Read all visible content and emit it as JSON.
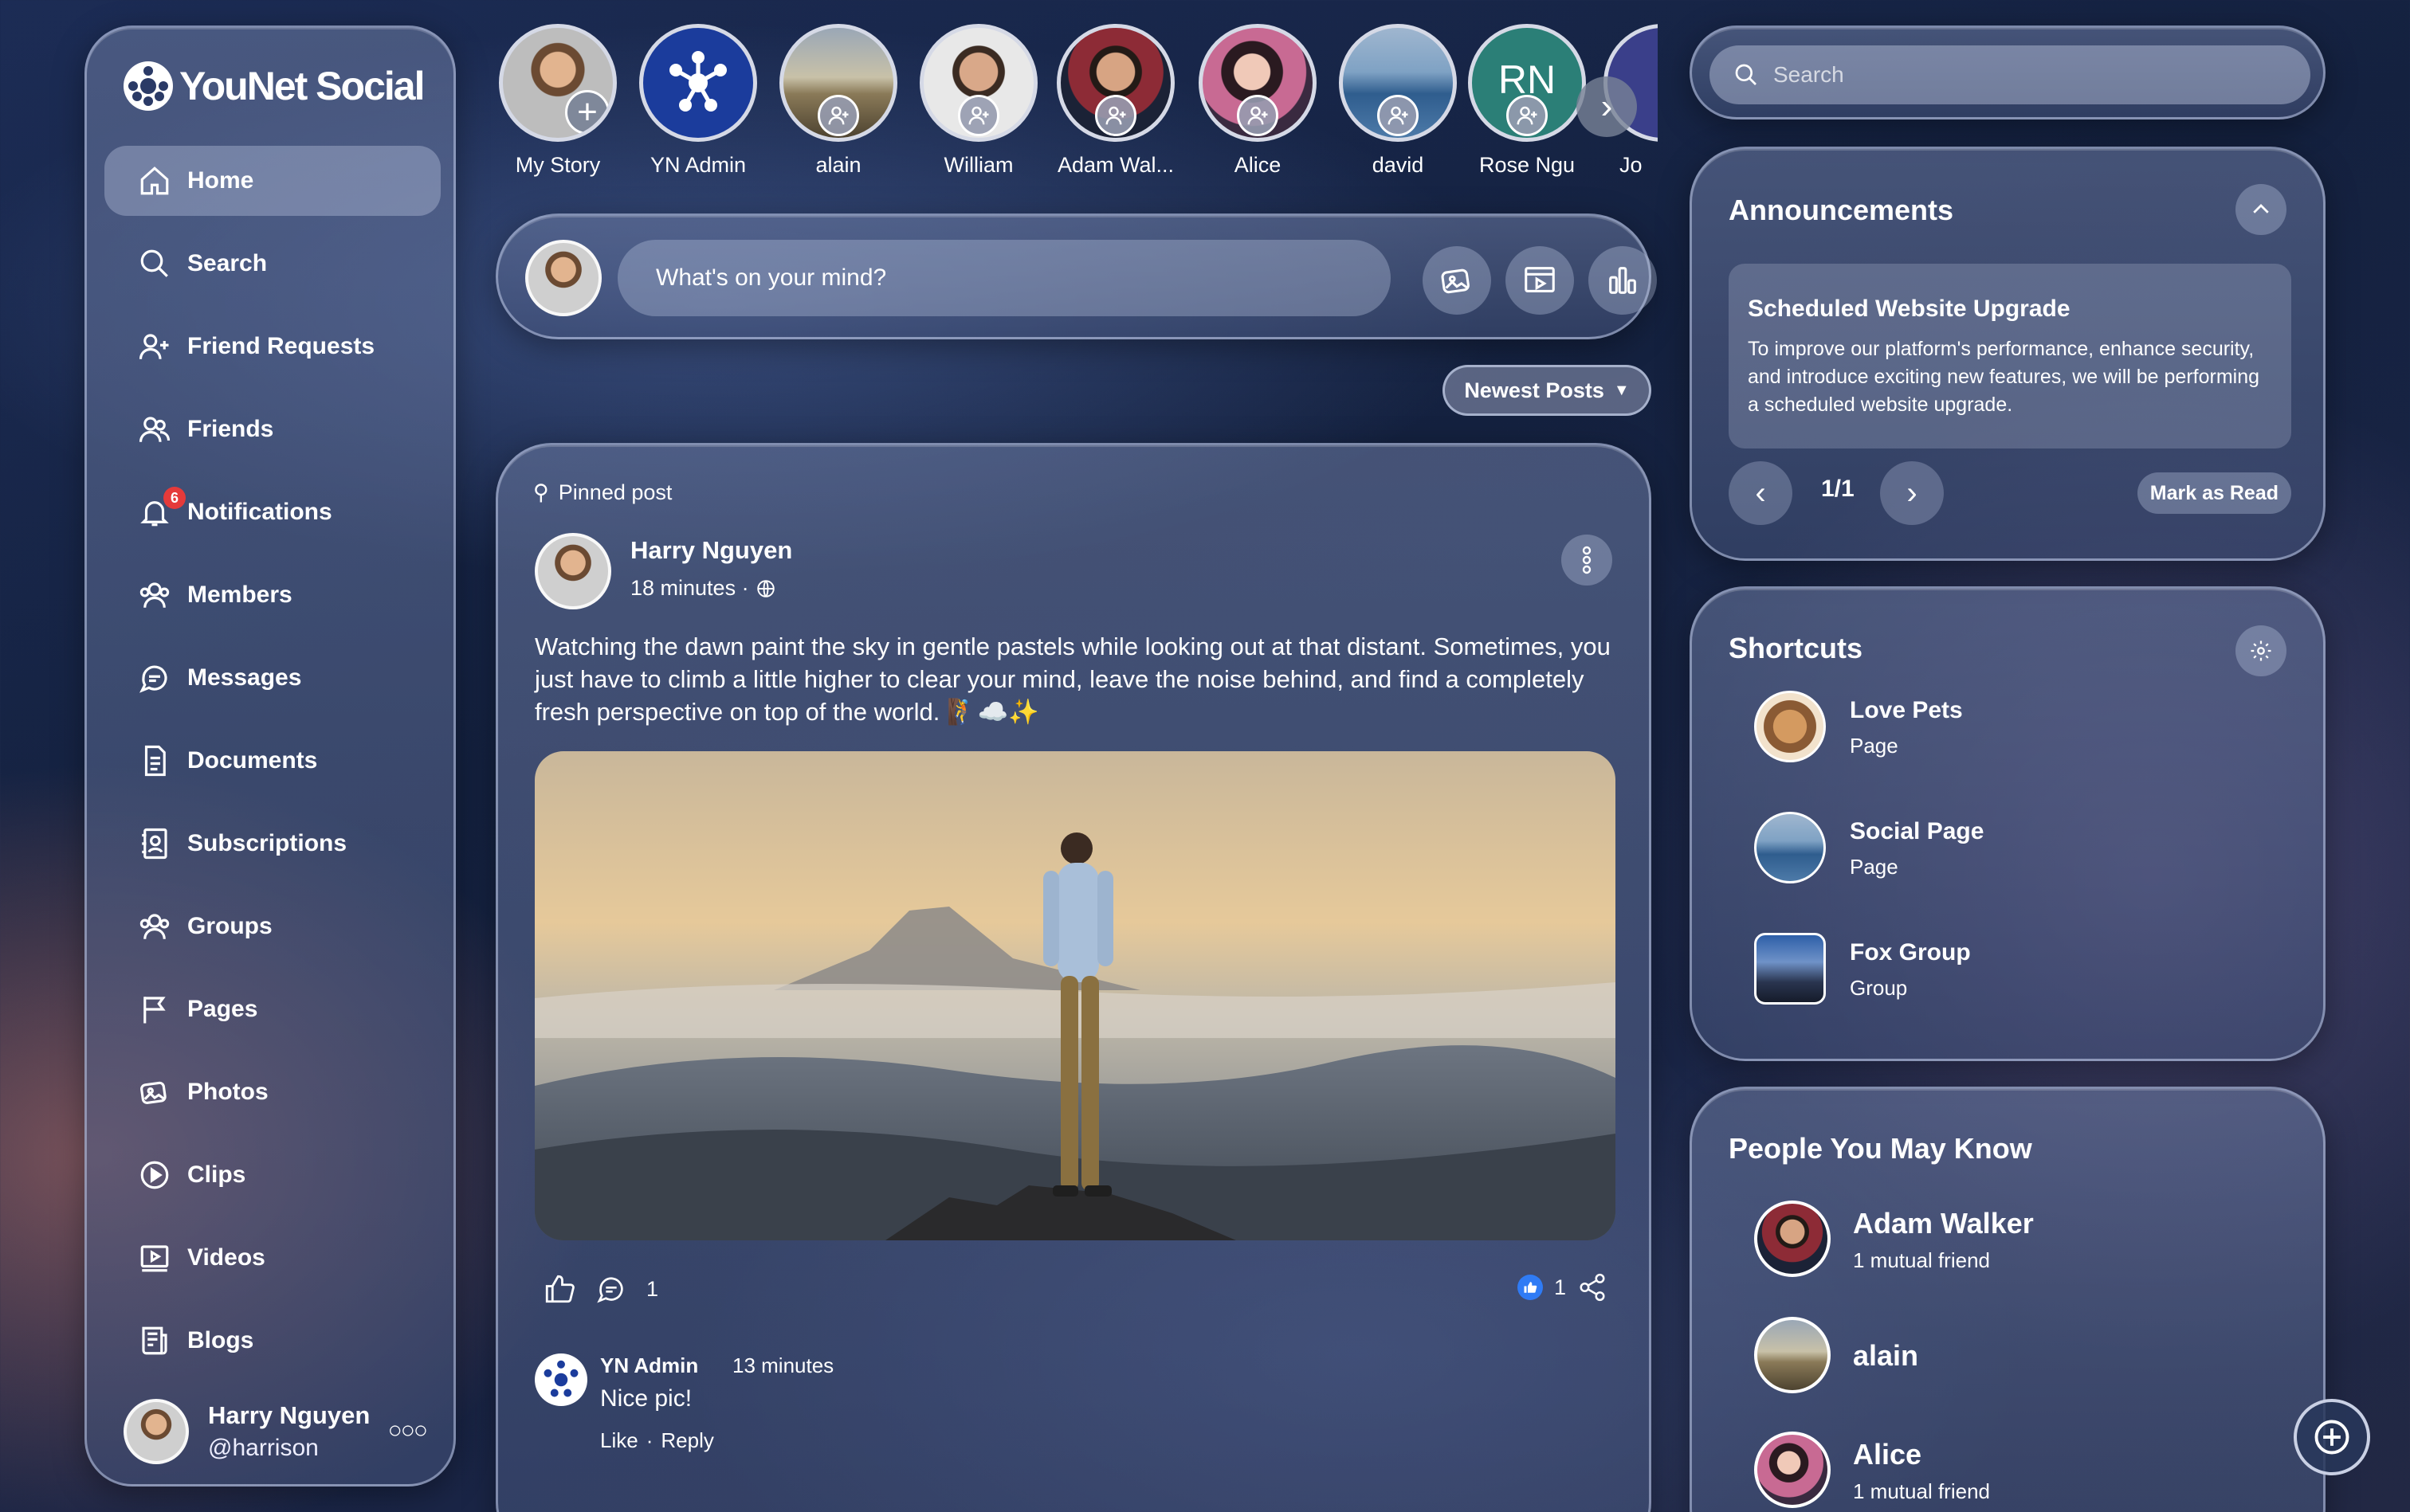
{
  "brand": {
    "name": "YouNet Social"
  },
  "nav": {
    "items": [
      {
        "label": "Home"
      },
      {
        "label": "Search"
      },
      {
        "label": "Friend Requests"
      },
      {
        "label": "Friends"
      },
      {
        "label": "Notifications",
        "badge": "6"
      },
      {
        "label": "Members"
      },
      {
        "label": "Messages"
      },
      {
        "label": "Documents"
      },
      {
        "label": "Subscriptions"
      },
      {
        "label": "Groups"
      },
      {
        "label": "Pages"
      },
      {
        "label": "Photos"
      },
      {
        "label": "Clips"
      },
      {
        "label": "Videos"
      },
      {
        "label": "Blogs"
      }
    ]
  },
  "profile": {
    "name": "Harry Nguyen",
    "handle": "@harrison"
  },
  "stories": [
    {
      "name": "My Story"
    },
    {
      "name": "YN Admin"
    },
    {
      "name": "alain"
    },
    {
      "name": "William"
    },
    {
      "name": "Adam Wal..."
    },
    {
      "name": "Alice"
    },
    {
      "name": "david"
    },
    {
      "name": "Rose Ngu",
      "initials": "RN"
    },
    {
      "name": "Jo"
    }
  ],
  "composer": {
    "placeholder": "What's on your mind?"
  },
  "sort": {
    "label": "Newest Posts"
  },
  "post": {
    "pinned_label": "Pinned post",
    "author": "Harry Nguyen",
    "time": "18 minutes ·",
    "text": "Watching the dawn paint the sky in gentle pastels while looking out at that distant. Sometimes, you just have to climb a little higher to clear your mind, leave the noise behind, and find a completely fresh perspective on top of the world. 🧗☁️✨",
    "comment_count": "1",
    "like_count": "1",
    "comment": {
      "author": "YN Admin",
      "time": "13 minutes",
      "text": "Nice pic!",
      "like": "Like",
      "sep": "·",
      "reply": "Reply"
    }
  },
  "search": {
    "placeholder": "Search"
  },
  "announcements": {
    "title": "Announcements",
    "item_title": "Scheduled Website Upgrade",
    "item_body": "To improve our platform's performance, enhance security, and introduce exciting new features, we will be performing a scheduled website upgrade.",
    "counter": "1/1",
    "mark_read": "Mark as Read"
  },
  "shortcuts": {
    "title": "Shortcuts",
    "items": [
      {
        "name": "Love Pets",
        "type": "Page"
      },
      {
        "name": "Social Page",
        "type": "Page"
      },
      {
        "name": "Fox Group",
        "type": "Group"
      }
    ]
  },
  "people": {
    "title": "People You May Know",
    "items": [
      {
        "name": "Adam Walker",
        "mutual": "1 mutual friend"
      },
      {
        "name": "alain",
        "mutual": ""
      },
      {
        "name": "Alice",
        "mutual": "1 mutual friend"
      }
    ]
  },
  "colors": {
    "like_blue": "#2f7bf5",
    "badge_red": "#e53a3a"
  }
}
